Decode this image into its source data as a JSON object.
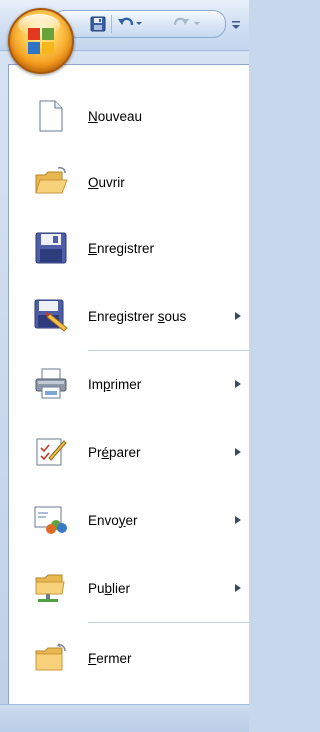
{
  "quick_access": {
    "save_icon": "save-icon",
    "undo_icon": "undo-icon",
    "redo_icon": "redo-icon",
    "customize_icon": "customize-icon"
  },
  "menu": {
    "items": [
      {
        "key": "new",
        "before": "",
        "accel": "N",
        "after": "ouveau",
        "has_submenu": false,
        "icon": "new-document-icon"
      },
      {
        "key": "open",
        "before": "",
        "accel": "O",
        "after": "uvrir",
        "has_submenu": false,
        "icon": "open-folder-icon"
      },
      {
        "key": "save",
        "before": "",
        "accel": "E",
        "after": "nregistrer",
        "has_submenu": false,
        "icon": "save-floppy-icon"
      },
      {
        "key": "save-as",
        "before": "Enregistrer ",
        "accel": "s",
        "after": "ous",
        "has_submenu": true,
        "icon": "save-as-icon"
      },
      {
        "key": "print",
        "before": "Im",
        "accel": "p",
        "after": "rimer",
        "has_submenu": true,
        "icon": "printer-icon"
      },
      {
        "key": "prepare",
        "before": "Pr",
        "accel": "é",
        "after": "parer",
        "has_submenu": true,
        "icon": "prepare-document-icon"
      },
      {
        "key": "send",
        "before": "Envo",
        "accel": "y",
        "after": "er",
        "has_submenu": true,
        "icon": "send-icon"
      },
      {
        "key": "publish",
        "before": "Pu",
        "accel": "b",
        "after": "lier",
        "has_submenu": true,
        "icon": "publish-icon"
      },
      {
        "key": "close",
        "before": "",
        "accel": "F",
        "after": "ermer",
        "has_submenu": false,
        "icon": "close-folder-icon"
      }
    ]
  },
  "colors": {
    "menu_background": "#ffffff",
    "frame_blue": "#c7d7ec",
    "divider": "#c5d0dc",
    "orb_orange": "#f39a1c"
  }
}
